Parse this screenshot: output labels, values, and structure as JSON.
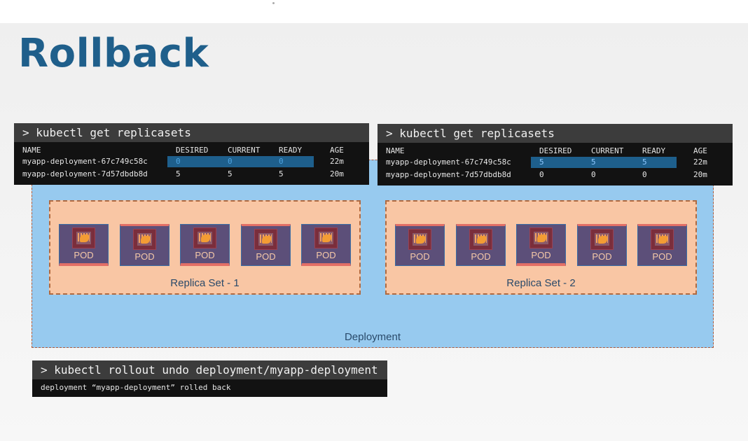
{
  "slide": {
    "title": "Rollback"
  },
  "left_terminal": {
    "command": "> kubectl get replicasets",
    "headers": [
      "NAME",
      "DESIRED",
      "CURRENT",
      "READY",
      "AGE"
    ],
    "rows": [
      [
        "myapp-deployment-67c749c58c",
        "0",
        "0",
        "0",
        "22m"
      ],
      [
        "myapp-deployment-7d57dbdb8d",
        "5",
        "5",
        "5",
        "20m"
      ]
    ]
  },
  "right_terminal": {
    "command": "> kubectl get replicasets",
    "headers": [
      "NAME",
      "DESIRED",
      "CURRENT",
      "READY",
      "AGE"
    ],
    "rows": [
      [
        "myapp-deployment-67c749c58c",
        "5",
        "5",
        "5",
        "22m"
      ],
      [
        "myapp-deployment-7d57dbdb8d",
        "0",
        "0",
        "0",
        "20m"
      ]
    ]
  },
  "deployment": {
    "label": "Deployment",
    "replica_sets": [
      {
        "label": "Replica Set - 1",
        "pods": [
          "POD",
          "POD",
          "POD",
          "POD",
          "POD"
        ]
      },
      {
        "label": "Replica Set - 2",
        "pods": [
          "POD",
          "POD",
          "POD",
          "POD",
          "POD"
        ]
      }
    ]
  },
  "undo_terminal": {
    "command": "> kubectl rollout undo deployment/myapp-deployment",
    "output": "deployment “myapp-deployment” rolled back"
  },
  "colors": {
    "title": "#1f5f8b",
    "deployment_bg": "#97caef",
    "replicaset_bg": "#f9c6a4",
    "pod_bg": "#5c4f79",
    "highlight": "#1e5f8c"
  },
  "icons": {
    "pod": "python-pod-icon"
  }
}
